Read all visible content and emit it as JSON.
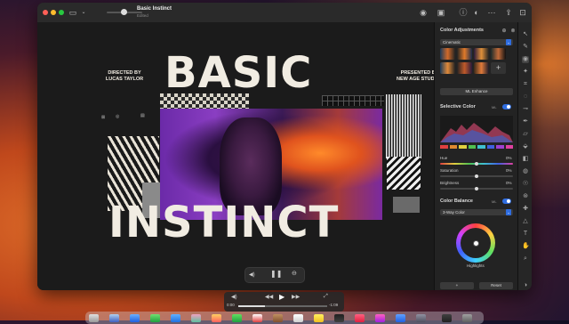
{
  "window": {
    "doc_title": "Basic Instinct",
    "doc_subtitle": "Edited"
  },
  "poster": {
    "title_top": "BASIC",
    "title_bottom": "INSTINCT",
    "left_credit": "DIRECTED BY\nLUCAS TAYLOR",
    "right_credit": "PRESENTED BY\nNEW AGE STUDIOS"
  },
  "sidebar": {
    "color_adjustments_title": "Color Adjustments",
    "preset_dropdown": "Cinematic",
    "ml_enhance_label": "ML Enhance",
    "selective_color_title": "Selective Color",
    "selective_color_badge": "ML",
    "params": [
      {
        "label": "Hue",
        "value": "0%",
        "level": 0.5
      },
      {
        "label": "Saturation",
        "value": "0%",
        "level": 0.5
      },
      {
        "label": "Brightness",
        "value": "0%",
        "level": 0.5
      }
    ],
    "color_balance_title": "Color Balance",
    "color_balance_badge": "ML",
    "color_balance_dropdown": "3-Way Color",
    "wheel_label": "Highlights",
    "bottom_left_button": "+ ",
    "reset_button": "Reset"
  },
  "player": {
    "time_start": "0:00",
    "time_end": "-1:09",
    "progress": 0.3
  },
  "playback_controls": {
    "volume_icon": "speaker-icon",
    "pause_icon": "pause-icon",
    "stop_icon": "stop-icon"
  },
  "colors": {
    "accent": "#2f6de0",
    "poster_text": "#f1ece2"
  }
}
